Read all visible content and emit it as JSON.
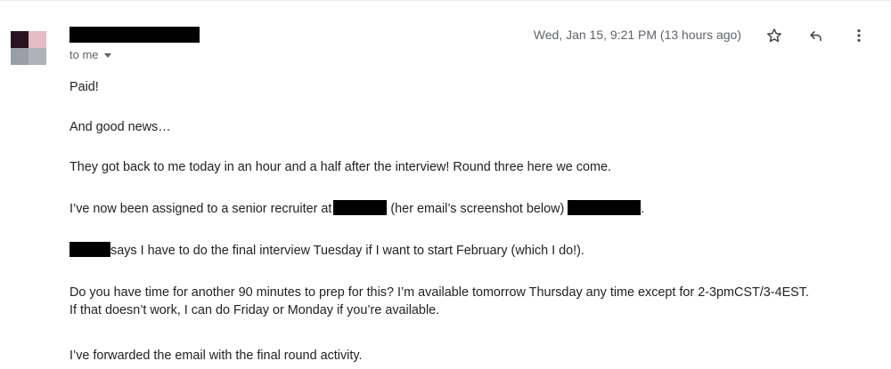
{
  "email": {
    "date": "Wed, Jan 15, 9:21 PM (13 hours ago)",
    "recipient_label": "to me",
    "body": {
      "p1": "Paid!",
      "p2": "And good news…",
      "p3": "They got back to me today in an hour and a half after the interview! Round three here we come.",
      "p4_a": "I’ve now been assigned to a senior recruiter at",
      "p4_b": "(her email’s screenshot below)",
      "p4_c": ".",
      "p5": "says I have to do the final interview Tuesday if I want to start February (which I do!).",
      "p6_line1": "Do you have time for another 90 minutes to prep for this? I’m available tomorrow Thursday any time except for 2-3pmCST/3-4EST.",
      "p6_line2": "If that doesn’t work, I can do Friday or Monday if you’re available.",
      "p7": "I’ve forwarded the email with the final round activity."
    }
  },
  "icons": {
    "star": "star-icon",
    "reply": "reply-icon",
    "more": "more-vert-icon",
    "caret": "caret-down-icon"
  },
  "colors": {
    "meta_text": "#5f6368",
    "body_text": "#222222",
    "redaction": "#000000"
  }
}
